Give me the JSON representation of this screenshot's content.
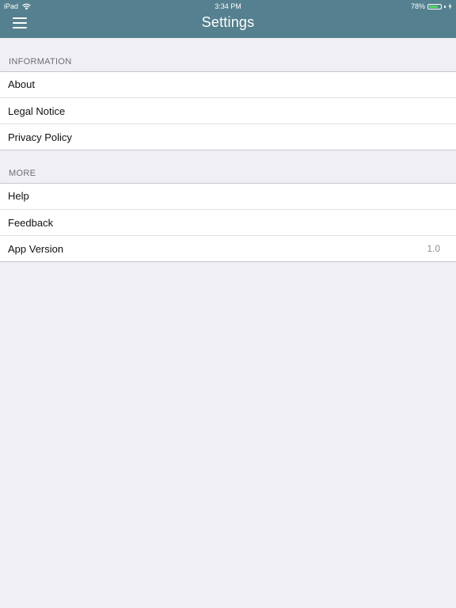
{
  "status_bar": {
    "device": "iPad",
    "time": "3:34 PM",
    "battery_percent": "78%",
    "battery_level": 0.78,
    "battery_color": "#4cd964"
  },
  "nav_bar": {
    "title": "Settings",
    "menu_icon": "hamburger-menu-icon",
    "background_color": "#55808f"
  },
  "sections": [
    {
      "header": "INFORMATION",
      "items": [
        {
          "label": "About"
        },
        {
          "label": "Legal Notice"
        },
        {
          "label": "Privacy Policy"
        }
      ]
    },
    {
      "header": "MORE",
      "items": [
        {
          "label": "Help"
        },
        {
          "label": "Feedback"
        },
        {
          "label": "App Version",
          "value": "1.0"
        }
      ]
    }
  ]
}
